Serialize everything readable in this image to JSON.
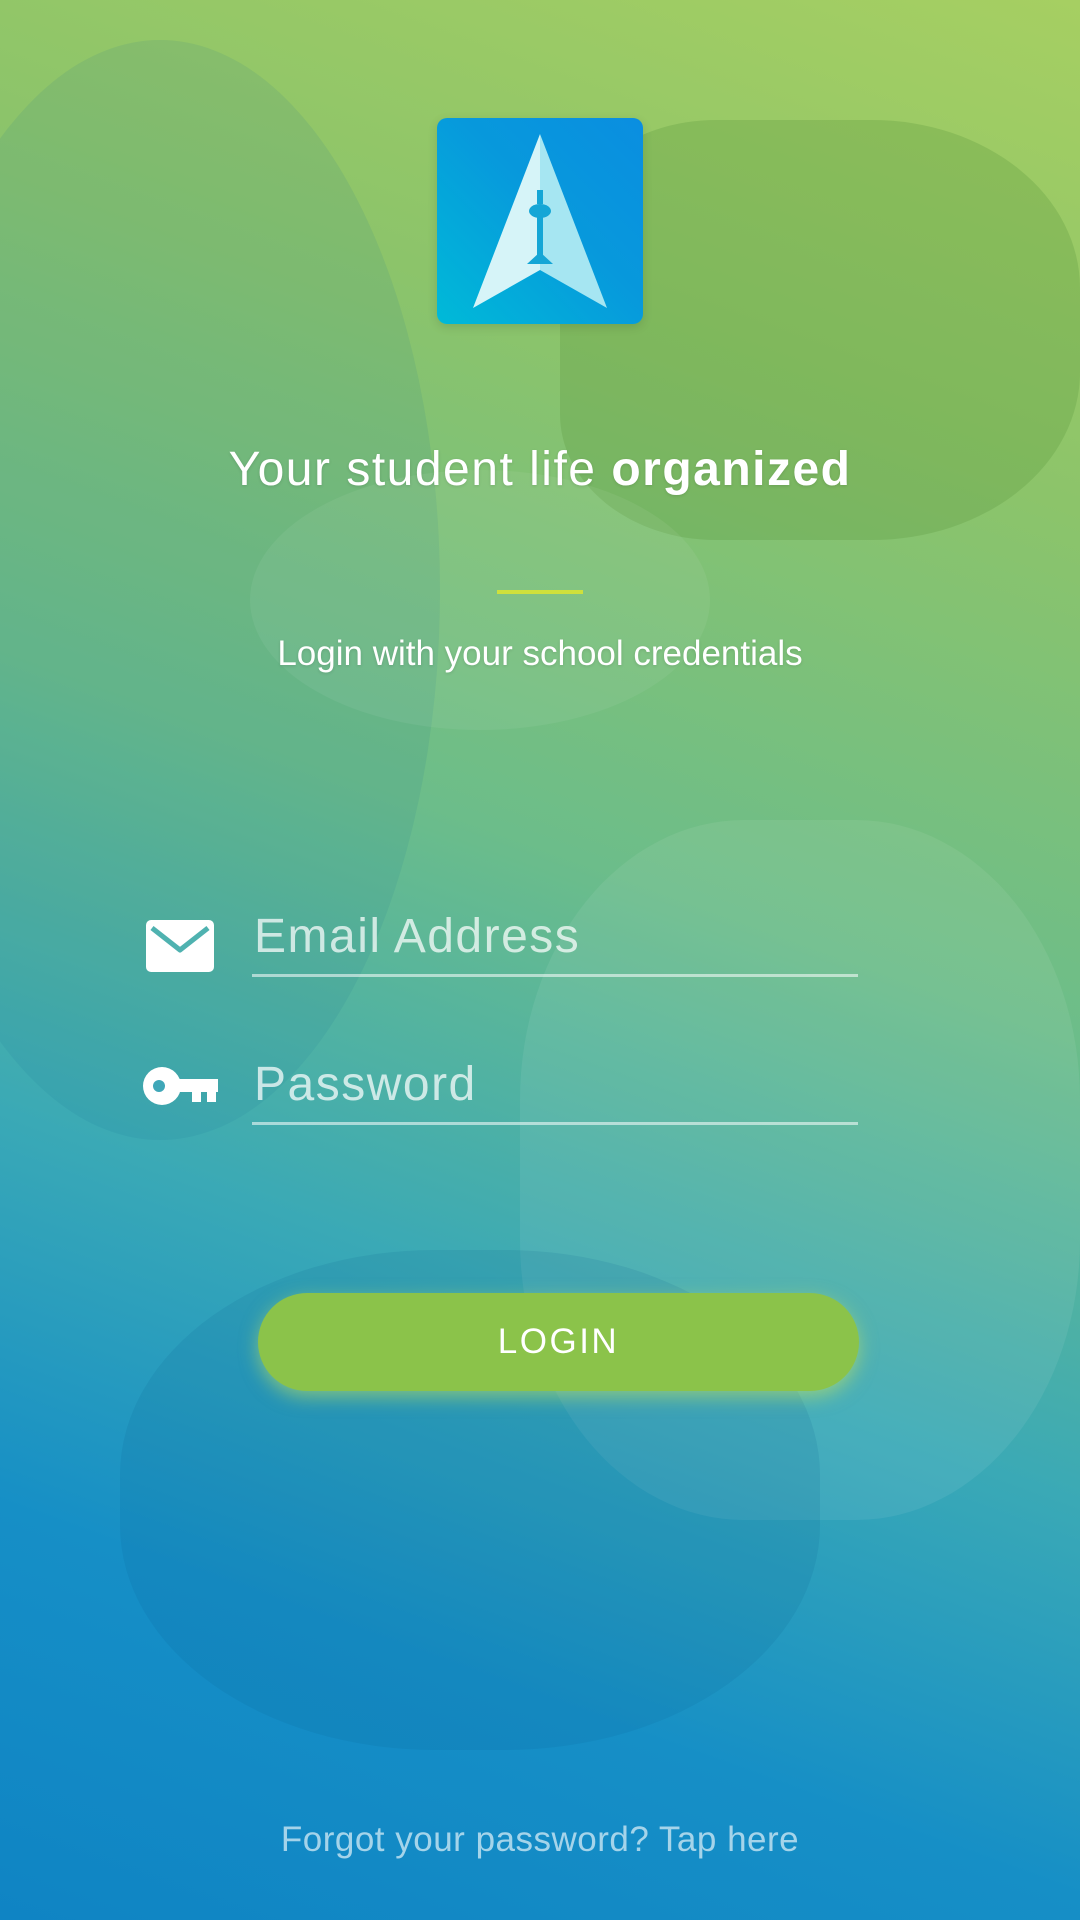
{
  "app": {
    "logo_icon": "app-logo-arrow-tower-icon",
    "accent_color": "#8bc34a",
    "divider_color": "#cfe03c"
  },
  "hero": {
    "tagline_regular": "Your student life ",
    "tagline_bold": "organized",
    "subtitle": "Login with your school credentials"
  },
  "form": {
    "email": {
      "icon": "envelope-icon",
      "placeholder": "Email Address",
      "value": ""
    },
    "password": {
      "icon": "key-icon",
      "placeholder": "Password",
      "value": ""
    },
    "login_label": "LOGIN"
  },
  "footer": {
    "forgot_text": "Forgot your password? Tap here"
  }
}
